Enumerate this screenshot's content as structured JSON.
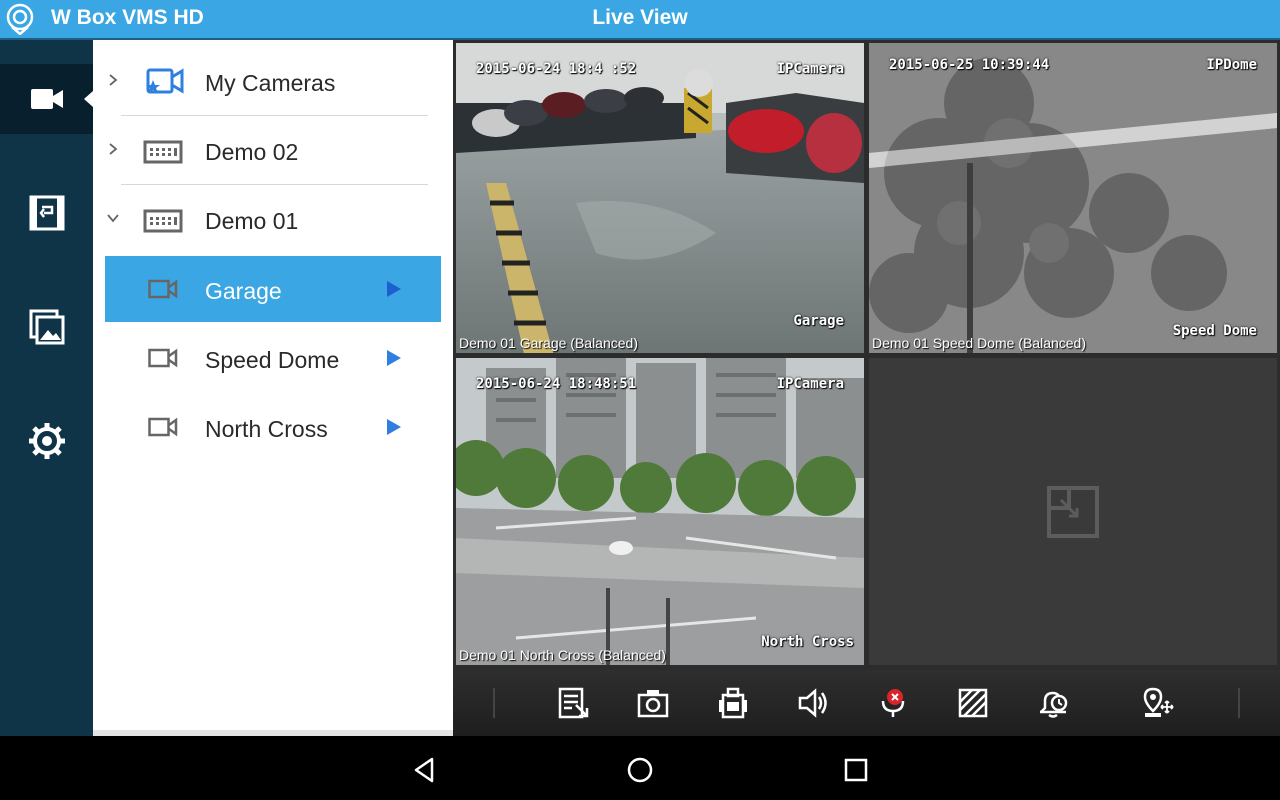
{
  "header": {
    "app_title": "W Box VMS HD",
    "page_title": "Live View"
  },
  "nav": {
    "items": [
      {
        "name": "live-view",
        "icon": "video-camera-icon",
        "active": true
      },
      {
        "name": "playback",
        "icon": "playback-film-icon",
        "active": false
      },
      {
        "name": "gallery",
        "icon": "image-gallery-icon",
        "active": false
      },
      {
        "name": "settings",
        "icon": "gear-icon",
        "active": false
      }
    ]
  },
  "device_tree": {
    "items": [
      {
        "label": "My Cameras",
        "type": "favorites",
        "icon": "star-camera-icon",
        "expandable": true,
        "expanded": false
      },
      {
        "label": "Demo 02",
        "type": "device",
        "icon": "dvr-device-icon",
        "expandable": true,
        "expanded": false
      },
      {
        "label": "Demo 01",
        "type": "device",
        "icon": "dvr-device-icon",
        "expandable": true,
        "expanded": true
      },
      {
        "label": "Garage",
        "type": "camera",
        "icon": "camera-icon",
        "selected": true,
        "playing": true
      },
      {
        "label": "Speed Dome",
        "type": "camera",
        "icon": "camera-icon",
        "selected": false,
        "playing": true
      },
      {
        "label": "North Cross",
        "type": "camera",
        "icon": "camera-icon",
        "selected": false,
        "playing": true
      }
    ]
  },
  "live_grid": {
    "layout": "2x2",
    "cells": [
      {
        "timestamp": "2015-06-24 18:4 :52",
        "camera_tag": "IPCamera",
        "channel_name": "Garage",
        "caption": "Demo 01 Garage (Balanced)",
        "active": true
      },
      {
        "timestamp": "2015-06-25 10:39:44",
        "camera_tag": "IPDome",
        "channel_name": "Speed Dome",
        "caption": "Demo 01 Speed Dome (Balanced)",
        "active": false
      },
      {
        "timestamp": "2015-06-24 18:48:51",
        "camera_tag": "IPCamera",
        "channel_name": "North Cross",
        "caption": "Demo 01 North Cross (Balanced)",
        "active": false
      },
      {
        "empty": true,
        "icon": "add-window-icon"
      }
    ]
  },
  "toolbar": {
    "buttons": [
      "stream-quality-icon",
      "snapshot-icon",
      "record-icon",
      "audio-icon",
      "talk-mic-icon",
      "fullscreen-icon",
      "alarm-icon",
      "ptz-icon"
    ]
  },
  "system_bar": {
    "buttons": [
      "back-icon",
      "home-icon",
      "recents-icon"
    ]
  },
  "colors": {
    "accent": "#3aa6e3",
    "nav_bg": "#0f3347",
    "play_arrow": "#2f7fe0"
  }
}
